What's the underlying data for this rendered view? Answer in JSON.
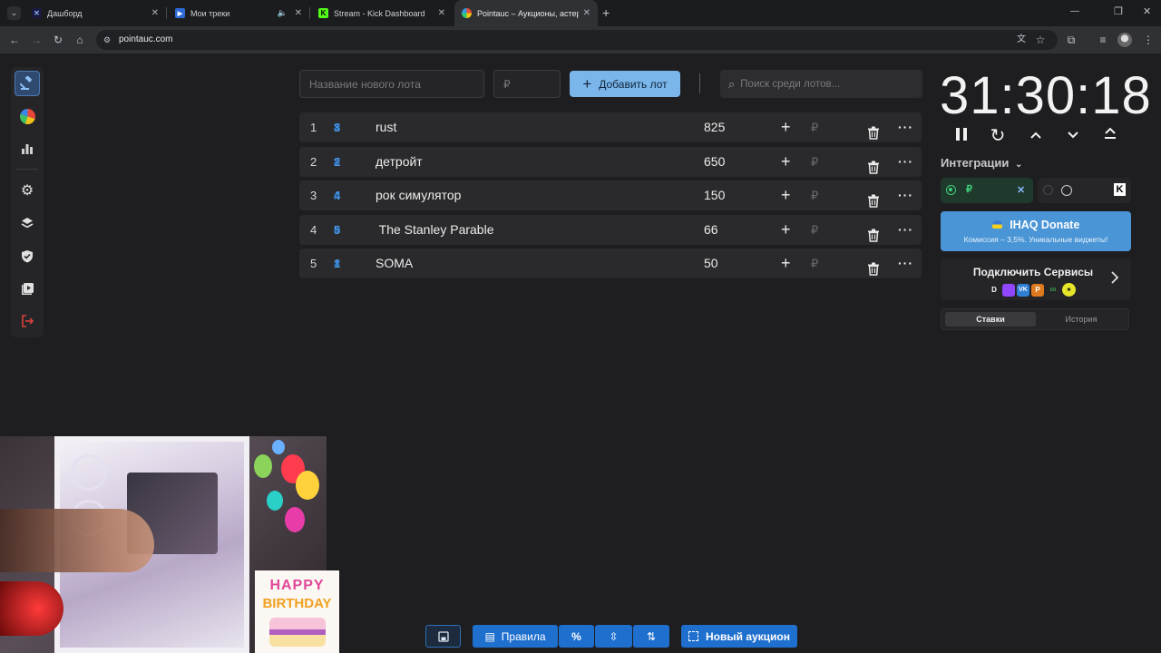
{
  "browser": {
    "tabs": [
      {
        "label": "Дашборд",
        "favicon": "x-logo-icon"
      },
      {
        "label": "Мои треки",
        "favicon": "play-icon",
        "muted": true
      },
      {
        "label": "Stream - Kick Dashboard",
        "favicon": "kick-icon"
      },
      {
        "label": "Pointauc – Аукционы, астерен",
        "favicon": "pointauc-icon",
        "active": true
      }
    ],
    "url": "pointauc.com"
  },
  "lot_form": {
    "name_placeholder": "Название нового лота",
    "amount_placeholder": "₽",
    "add_button": "Добавить лот",
    "search_placeholder": "Поиск среди лотов..."
  },
  "lots": [
    {
      "rank": "1",
      "id_hash": "#",
      "id_num": "3",
      "name": "rust",
      "amount": "825"
    },
    {
      "rank": "2",
      "id_hash": "#",
      "id_num": "2",
      "name": "детройт",
      "amount": "650"
    },
    {
      "rank": "3",
      "id_hash": "#",
      "id_num": "4",
      "name": "рок симулятор",
      "amount": "150"
    },
    {
      "rank": "4",
      "id_hash": "#",
      "id_num": "5",
      "name": " The Stanley Parable",
      "amount": "66"
    },
    {
      "rank": "5",
      "id_hash": "#",
      "id_num": "1",
      "name": "SOMA",
      "amount": "50"
    }
  ],
  "lot_currency": "₽",
  "timer": "31:30:18",
  "integrations": {
    "label": "Интеграции",
    "donate_title": "IHAQ Donate",
    "donate_subtitle": "Комиссия – 3,5%. Уникальные виджеты!",
    "connect_label": "Подключить Сервисы"
  },
  "panel_tabs": [
    "Ставки",
    "История"
  ],
  "bottom_toolbar": {
    "rules": "Правила",
    "percent": "%",
    "new_auction": "Новый аукцион"
  },
  "birthday_text": [
    "HAPPY",
    "BIRTHDAY"
  ],
  "colors": {
    "accent": "#7ab6ea",
    "primary_button": "#1f6fce",
    "id_blue": "#2f7fd4",
    "danger": "#d9413a"
  }
}
